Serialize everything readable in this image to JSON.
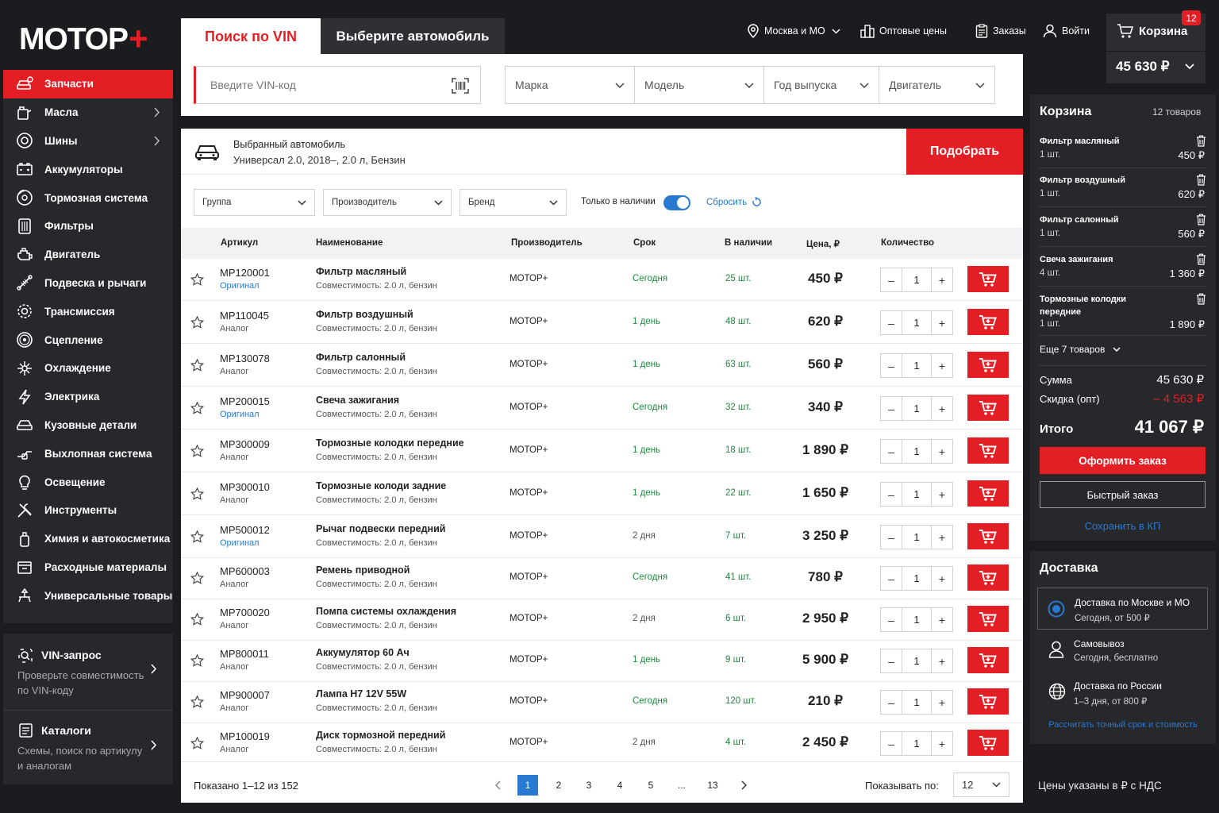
{
  "logo": {
    "text": "МОТОР",
    "plus": "+"
  },
  "sidebar": {
    "items": [
      {
        "label": "Запчасти",
        "icon": "car-parts-icon",
        "active": true,
        "arrow": false
      },
      {
        "label": "Масла",
        "icon": "oil-can-icon",
        "arrow": true
      },
      {
        "label": "Шины",
        "icon": "tire-icon",
        "arrow": true
      },
      {
        "label": "Аккумуляторы",
        "icon": "battery-icon",
        "arrow": false
      },
      {
        "label": "Тормозная система",
        "icon": "brake-disc-icon",
        "arrow": false
      },
      {
        "label": "Фильтры",
        "icon": "filter-icon",
        "arrow": false
      },
      {
        "label": "Двигатель",
        "icon": "engine-icon",
        "arrow": false
      },
      {
        "label": "Подвеска и рычаги",
        "icon": "suspension-icon",
        "arrow": false
      },
      {
        "label": "Трансмиссия",
        "icon": "gear-icon",
        "arrow": false
      },
      {
        "label": "Сцепление",
        "icon": "clutch-icon",
        "arrow": false
      },
      {
        "label": "Охлаждение",
        "icon": "cooling-icon",
        "arrow": false
      },
      {
        "label": "Электрика",
        "icon": "lightning-icon",
        "arrow": false
      },
      {
        "label": "Кузовные детали",
        "icon": "car-body-icon",
        "arrow": false
      },
      {
        "label": "Выхлопная система",
        "icon": "exhaust-icon",
        "arrow": false
      },
      {
        "label": "Освещение",
        "icon": "bulb-icon",
        "arrow": false
      },
      {
        "label": "Инструменты",
        "icon": "tools-icon",
        "arrow": false
      },
      {
        "label": "Химия и автокосметика",
        "icon": "chemistry-icon",
        "arrow": false
      },
      {
        "label": "Расходные материалы",
        "icon": "consumables-icon",
        "arrow": false
      },
      {
        "label": "Универсальные товары",
        "icon": "universal-icon",
        "arrow": false
      }
    ],
    "vin_box": {
      "title": "VIN-запрос",
      "desc_line1": "Проверьте совместимость",
      "desc_line2": "по VIN-коду"
    },
    "catalog_box": {
      "title": "Каталоги",
      "desc_line1": "Схемы, поиск по артикулу",
      "desc_line2": "и аналогам"
    }
  },
  "search": {
    "tab_vin": "Поиск по VIN",
    "tab_car": "Выберите автомобиль",
    "vin_placeholder": "Введите VIN-код",
    "selects": [
      "Марка",
      "Модель",
      "Год выпуска",
      "Двигатель"
    ]
  },
  "header": {
    "region": "Москва и МО",
    "wholesale": "Оптовые цены",
    "orders": "Заказы",
    "login": "Войти",
    "cart_label": "Корзина",
    "cart_badge": "12",
    "cart_total": "45 630 ₽"
  },
  "selected_car": {
    "label": "Выбранный автомобиль",
    "value": "Универсал 2.0, 2018–, 2.0 л, Бензин",
    "button": "Подобрать"
  },
  "filters": {
    "group": "Группа",
    "maker": "Производитель",
    "brand": "Бренд",
    "in_stock": "Только в наличии",
    "reset": "Сбросить"
  },
  "table": {
    "headers": {
      "article": "Артикул",
      "name": "Наименование",
      "maker": "Производитель",
      "term": "Срок",
      "stock": "В наличии",
      "price": "Цена, ₽",
      "qty": "Количество"
    },
    "rows": [
      {
        "article": "MP120001",
        "kind": "Оригинал",
        "name": "Фильтр масляный",
        "compat": "Совместимость: 2.0 л, бензин",
        "maker": "МОТОР+",
        "term": "Сегодня",
        "stock": "25 шт.",
        "price": "450 ₽",
        "qty": "1"
      },
      {
        "article": "MP110045",
        "kind": "Аналог",
        "name": "Фильтр воздушный",
        "compat": "Совместимость: 2.0 л, бензин",
        "maker": "МОТОР+",
        "term": "1 день",
        "stock": "48 шт.",
        "price": "620 ₽",
        "qty": "1"
      },
      {
        "article": "MP130078",
        "kind": "Аналог",
        "name": "Фильтр салонный",
        "compat": "Совместимость: 2.0 л, бензин",
        "maker": "МОТОР+",
        "term": "1 день",
        "stock": "63 шт.",
        "price": "560 ₽",
        "qty": "1"
      },
      {
        "article": "MP200015",
        "kind": "Оригинал",
        "name": "Свеча зажигания",
        "compat": "Совместимость: 2.0 л, бензин",
        "maker": "МОТОР+",
        "term": "Сегодня",
        "stock": "32 шт.",
        "price": "340 ₽",
        "qty": "1"
      },
      {
        "article": "MP300009",
        "kind": "Аналог",
        "name": "Тормозные колодки передние",
        "compat": "Совместимость: 2.0 л, бензин",
        "maker": "МОТОР+",
        "term": "1 день",
        "stock": "18 шт.",
        "price": "1 890 ₽",
        "qty": "1"
      },
      {
        "article": "MP300010",
        "kind": "Аналог",
        "name": "Тормозные колоди задние",
        "compat": "Совместимость: 2.0 л, бензин",
        "maker": "МОТОР+",
        "term": "1 день",
        "stock": "22 шт.",
        "price": "1 650 ₽",
        "qty": "1"
      },
      {
        "article": "MP500012",
        "kind": "Оригинал",
        "name": "Рычаг подвески передний",
        "compat": "Совместимость: 2.0 л, бензин",
        "maker": "МОТОР+",
        "term": "2 дня",
        "stock": "7 шт.",
        "price": "3 250 ₽",
        "qty": "1"
      },
      {
        "article": "MP600003",
        "kind": "Аналог",
        "name": "Ремень приводной",
        "compat": "Совместимость: 2.0 л, бензин",
        "maker": "МОТОР+",
        "term": "Сегодня",
        "stock": "41 шт.",
        "price": "780 ₽",
        "qty": "1"
      },
      {
        "article": "MP700020",
        "kind": "Аналог",
        "name": "Помпа системы охлаждения",
        "compat": "Совместимость: 2.0 л, бензин",
        "maker": "МОТОР+",
        "term": "2 дня",
        "stock": "6 шт.",
        "price": "2 950 ₽",
        "qty": "1"
      },
      {
        "article": "MP800011",
        "kind": "Аналог",
        "name": "Аккумулятор 60 Ач",
        "compat": "Совместимость: 2.0 л, бензин",
        "maker": "МОТОР+",
        "term": "1 день",
        "stock": "9 шт.",
        "price": "5 900 ₽",
        "qty": "1"
      },
      {
        "article": "MP900007",
        "kind": "Аналог",
        "name": "Лампа H7 12V 55W",
        "compat": "Совместимость: 2.0 л, бензин",
        "maker": "МОТОР+",
        "term": "Сегодня",
        "stock": "120 шт.",
        "price": "210 ₽",
        "qty": "1"
      },
      {
        "article": "MP100019",
        "kind": "Аналог",
        "name": "Диск тормозной передний",
        "compat": "Совместимость: 2.0 л, бензин",
        "maker": "МОТОР+",
        "term": "2 дня",
        "stock": "4 шт.",
        "price": "2 450 ₽",
        "qty": "1"
      }
    ]
  },
  "pagination": {
    "shown": "Показано 1–12 из 152",
    "pages": [
      "1",
      "2",
      "3",
      "4",
      "5",
      "...",
      "13"
    ],
    "current": "1",
    "per_page_label": "Показывать по:",
    "per_page": "12"
  },
  "cart": {
    "title": "Корзина",
    "count": "12 товаров",
    "items": [
      {
        "name_line1": "Фильтр масляный",
        "name_line2": "",
        "qty": "1 шт.",
        "price": "450 ₽"
      },
      {
        "name_line1": "Фильтр воздушный",
        "name_line2": "",
        "qty": "1 шт.",
        "price": "620 ₽"
      },
      {
        "name_line1": "Фильтр салонный",
        "name_line2": "",
        "qty": "1 шт.",
        "price": "560 ₽"
      },
      {
        "name_line1": "Свеча зажигания",
        "name_line2": "",
        "qty": "4 шт.",
        "price": "1 360 ₽"
      },
      {
        "name_line1": "Тормозные колодки",
        "name_line2": "передние",
        "qty": "1 шт.",
        "price": "1 890 ₽"
      }
    ],
    "more": "Еще 7 товаров",
    "sum_label": "Сумма",
    "sum": "45 630 ₽",
    "discount_label": "Скидка (опт)",
    "discount": "– 4 563 ₽",
    "total_label": "Итого",
    "total": "41 067 ₽",
    "checkout": "Оформить заказ",
    "quick": "Быстрый заказ",
    "save": "Сохранить в КП"
  },
  "delivery": {
    "title": "Доставка",
    "options": [
      {
        "title": "Доставка по Москве и МО",
        "sub": "Сегодня, от 500 ₽"
      },
      {
        "title": "Самовывоз",
        "sub": "Сегодня, бесплатно"
      },
      {
        "title": "Доставка по России",
        "sub": "1–3 дня, от 800 ₽"
      }
    ],
    "calc": "Рассчитать точный срок и стоимость"
  },
  "footer_note": "Цены указаны в ₽ с НДС",
  "colors": {
    "accent": "#e31e24",
    "link": "#2a79d0",
    "stock_green": "#1e8a3e",
    "dark_bg": "#1b1c1f",
    "panel": "#26282c"
  }
}
